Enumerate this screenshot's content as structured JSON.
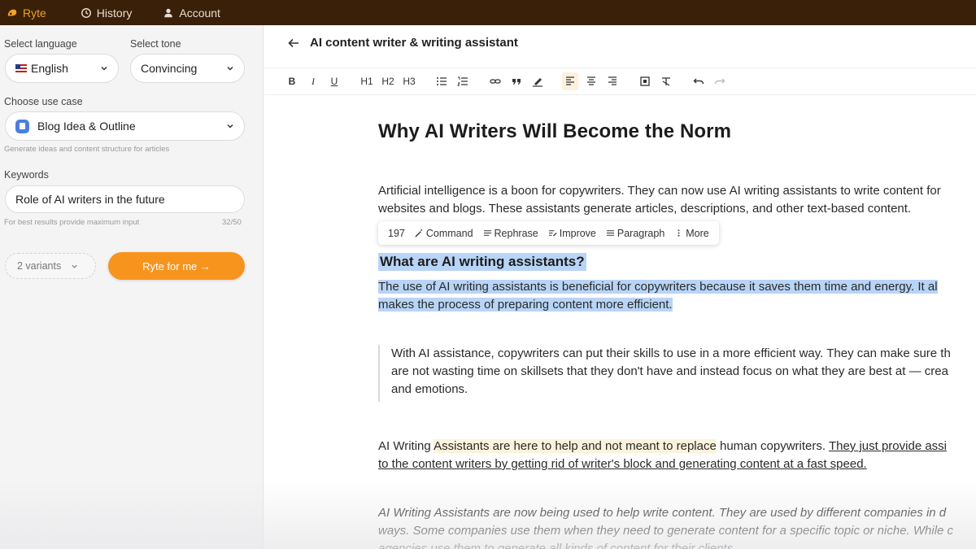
{
  "topbar": {
    "brand": "Ryte",
    "history": "History",
    "account": "Account",
    "icons": [
      "ryte-logo-icon",
      "history-clock-icon",
      "user-icon"
    ]
  },
  "sidebar": {
    "language_label": "Select language",
    "language_value": "English",
    "tone_label": "Select tone",
    "tone_value": "Convincing",
    "use_case_label": "Choose use case",
    "use_case_value": "Blog Idea & Outline",
    "use_case_hint": "Generate ideas and content structure for articles",
    "keywords_label": "Keywords",
    "keywords_value": "Role of AI writers in the future",
    "keywords_hint": "For best results provide maximum input",
    "keywords_count": "32/50",
    "variants_value": "2 variants",
    "ryte_button": "Ryte for me →",
    "accent_color": "#f7941d"
  },
  "main": {
    "header_title": "AI content writer & writing assistant",
    "toolbar": [
      "B",
      "I",
      "U",
      "H1",
      "H2",
      "H3"
    ],
    "doc": {
      "title": "Why AI Writers Will Become the Norm",
      "p1_line1": "Artificial intelligence is a boon for copywriters. They can now use AI writing assistants to write content for",
      "p1_line2": "websites and blogs. These assistants generate articles, descriptions, and other text-based content.",
      "popup": {
        "count": "197",
        "command": "Command",
        "rephrase": "Rephrase",
        "improve": "Improve",
        "paragraph": "Paragraph",
        "more": "More"
      },
      "heading2": "What are AI writing assistants?",
      "p2_line1": "The use of AI writing assistants is beneficial for copywriters because it saves them time and energy. It al",
      "p2_line2": "makes the process of preparing content more efficient.",
      "quote_line1": "With AI assistance, copywriters can put their skills to use in a more efficient way. They can make sure th",
      "quote_line2": "are not wasting time on skillsets that they don't have and instead focus on what they are best at — crea",
      "quote_line3": "and emotions.",
      "p3_a": "AI Writing ",
      "p3_b": "Assistants are here to help and not meant to replace",
      "p3_c": " human copywriters. ",
      "p3_d": "They just provide assi",
      "p3_line2": "to the content writers by getting rid of writer's block and generating content at a fast speed.",
      "p4_line1": "AI Writing Assistants are now being used to help write content. They are used by different companies in d",
      "p4_line2": "ways. Some companies use them when they need to generate content for a specific topic or niche. While c",
      "p4_line3": "agencies use them to generate all kinds of content for their clients."
    }
  }
}
